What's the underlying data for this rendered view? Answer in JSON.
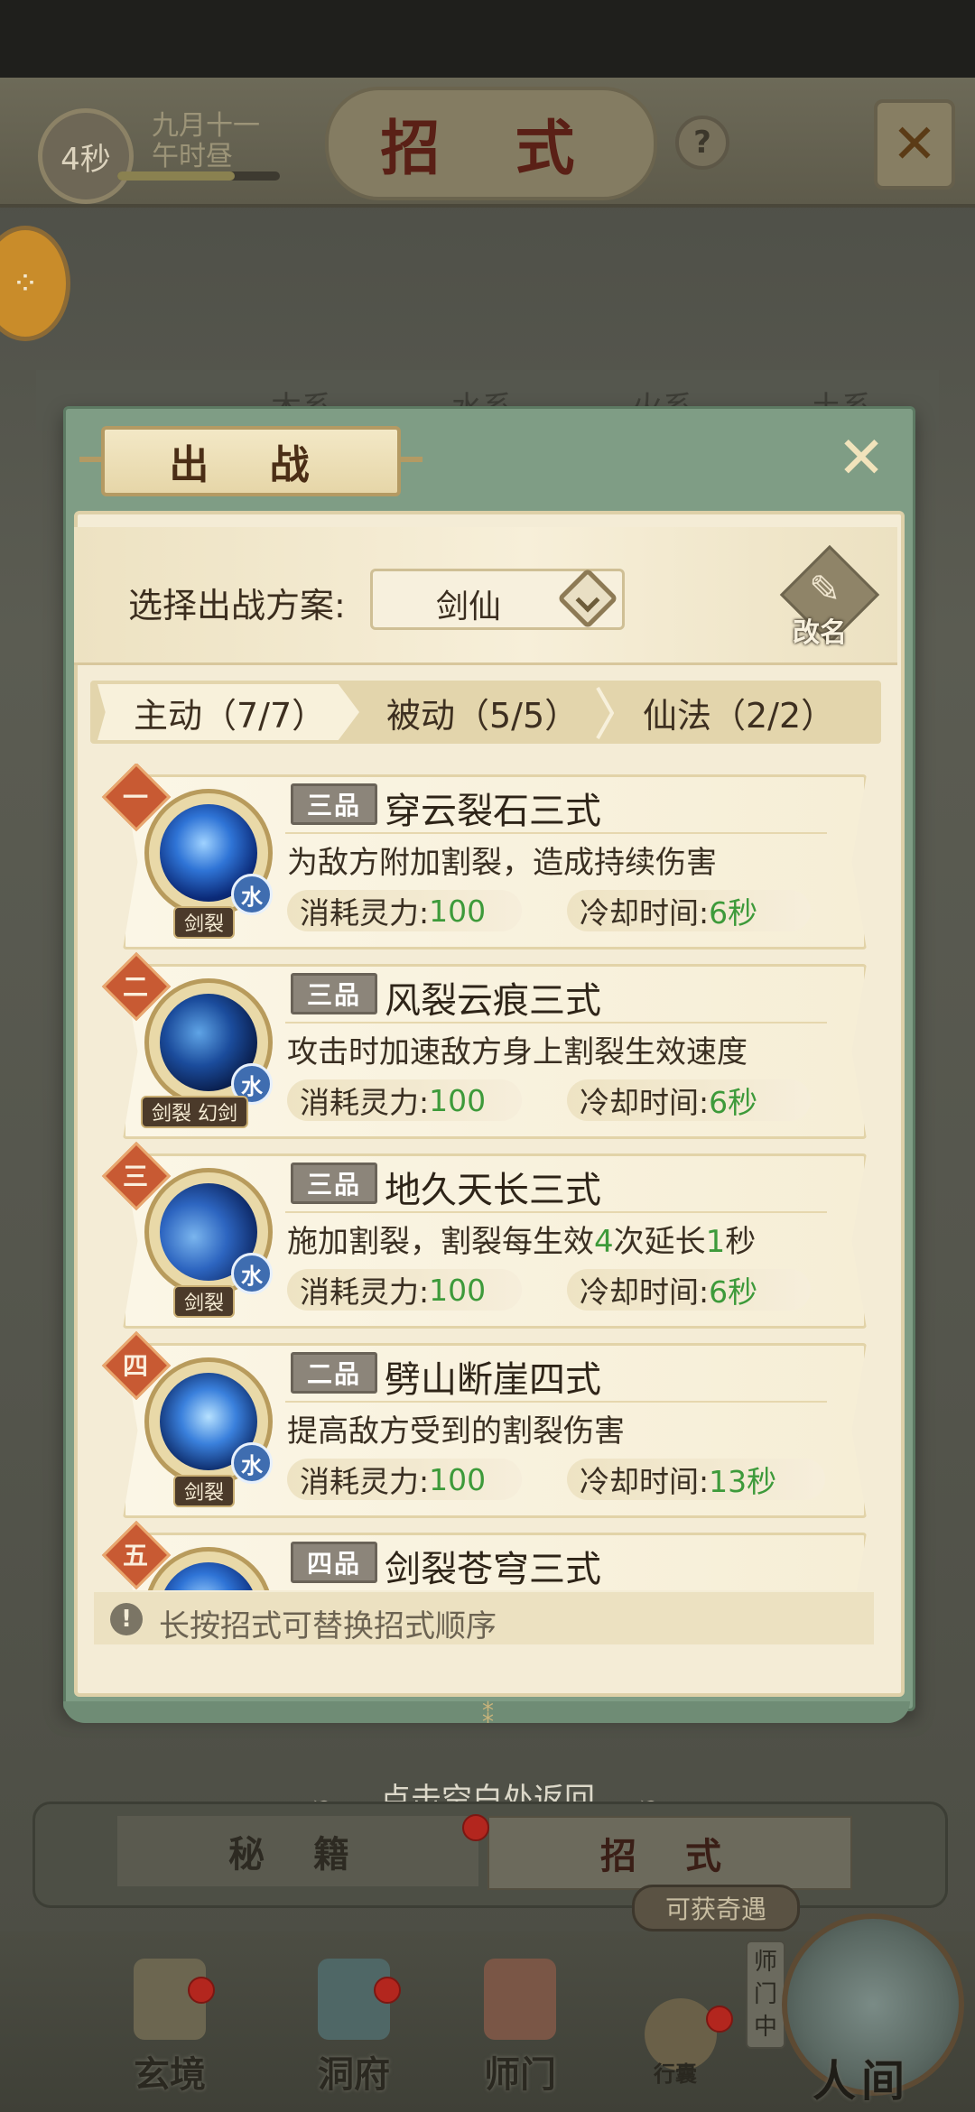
{
  "header": {
    "timer": "4秒",
    "date_line1": "九月十一",
    "date_line2": "午时昼",
    "title": "招 式",
    "help_glyph": "?",
    "close_glyph": "✕"
  },
  "background_tabs": [
    "木系",
    "水系",
    "火系",
    "土系"
  ],
  "dialog": {
    "title": "出 战",
    "close_glyph": "✕",
    "scheme_label": "选择出战方案:",
    "scheme_value": "剑仙",
    "rename_label": "改名",
    "tabs": [
      "主动（7/7）",
      "被动（5/5）",
      "仙法（2/2）"
    ],
    "cost_label": "消耗灵力:",
    "cooldown_label": "冷却时间:",
    "skills": [
      {
        "rank": "一",
        "grade": "三品",
        "name": "穿云裂石三式",
        "desc": "为敌方附加割裂，造成持续伤害",
        "cost": "100",
        "cooldown": "6秒",
        "element": "水",
        "tag": "剑裂"
      },
      {
        "rank": "二",
        "grade": "三品",
        "name": "风裂云痕三式",
        "desc": "攻击时加速敌方身上割裂生效速度",
        "cost": "100",
        "cooldown": "6秒",
        "element": "水",
        "tag": "剑裂 幻剑"
      },
      {
        "rank": "三",
        "grade": "三品",
        "name": "地久天长三式",
        "desc_parts": [
          "施加割裂，割裂每生效",
          "4",
          "次延长",
          "1",
          "秒"
        ],
        "cost": "100",
        "cooldown": "6秒",
        "element": "水",
        "tag": "剑裂"
      },
      {
        "rank": "四",
        "grade": "二品",
        "name": "劈山断崖四式",
        "desc": "提高敌方受到的割裂伤害",
        "cost": "100",
        "cooldown": "13秒",
        "element": "水",
        "tag": "剑裂"
      },
      {
        "rank": "五",
        "grade": "四品",
        "name": "剑裂苍穹三式"
      }
    ],
    "hint_icon": "!",
    "hint": "长按招式可替换招式顺序"
  },
  "return_hint": "点击空白处返回",
  "bottom_tabs": {
    "secret": "秘 籍",
    "moves": "招 式"
  },
  "opportunity": "可获奇遇",
  "nav": {
    "items": [
      "玄境",
      "洞府",
      "师门"
    ],
    "purse": "行囊",
    "sect_vertical": "师门中",
    "world": "人间"
  },
  "colors": {
    "accent_green": "#3d9a3a",
    "badge_red": "#c85a33",
    "dialog_frame": "#7f9d85",
    "panel_bg": "#f4ecd6"
  }
}
